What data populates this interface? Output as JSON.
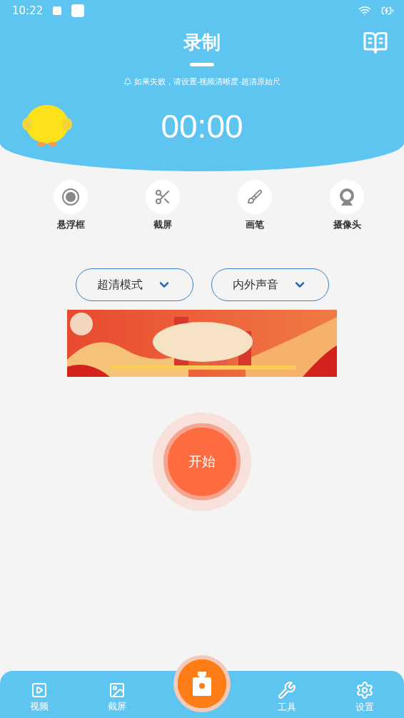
{
  "status_bar": {
    "time": "10:22"
  },
  "header": {
    "title": "录制",
    "notice": "如果失败，请设置-视频清晰度-超清原始尺",
    "timer": "00:00"
  },
  "tools": [
    {
      "label": "悬浮框"
    },
    {
      "label": "截屏"
    },
    {
      "label": "画笔"
    },
    {
      "label": "摄像头"
    }
  ],
  "dropdowns": [
    {
      "value": "超清模式"
    },
    {
      "value": "内外声音"
    }
  ],
  "start_button": {
    "label": "开始"
  },
  "bottom_nav": [
    {
      "kind": "tab",
      "label": "视频",
      "selected": false
    },
    {
      "kind": "tab",
      "label": "截屏",
      "selected": false
    },
    {
      "kind": "center"
    },
    {
      "kind": "tab",
      "label": "工具",
      "selected": false
    },
    {
      "kind": "tab",
      "label": "设置",
      "selected": false
    }
  ]
}
